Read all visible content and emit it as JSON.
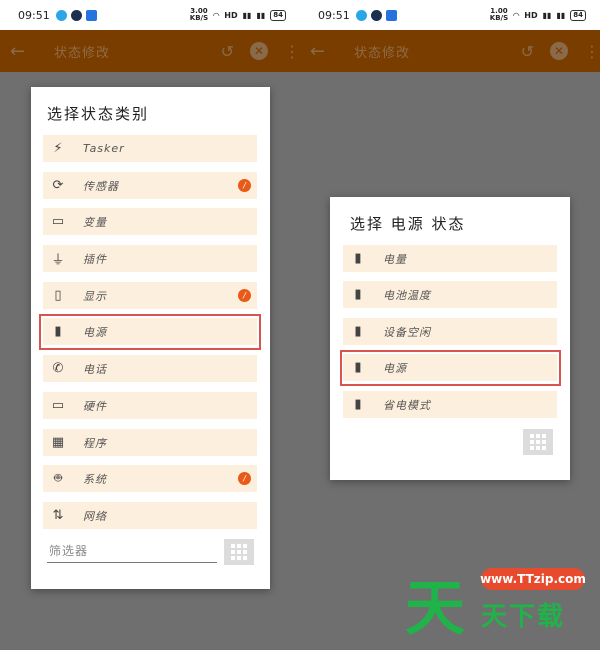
{
  "left": {
    "status": {
      "time": "09:51",
      "speed_top": "3.00",
      "speed_bottom": "KB/S",
      "hd": "HD",
      "battery": "84"
    },
    "toolbar": {
      "title": "状态修改"
    },
    "dialog": {
      "title": "选择状态类别",
      "items": [
        {
          "label": "Tasker",
          "icon": "bolt-icon",
          "badge": false
        },
        {
          "label": "传感器",
          "icon": "screen-rotate-icon",
          "badge": true
        },
        {
          "label": "变量",
          "icon": "tag-icon",
          "badge": false
        },
        {
          "label": "插件",
          "icon": "plug-icon",
          "badge": false
        },
        {
          "label": "显示",
          "icon": "phone-icon",
          "badge": true
        },
        {
          "label": "电源",
          "icon": "battery-icon",
          "badge": false
        },
        {
          "label": "电话",
          "icon": "call-icon",
          "badge": false
        },
        {
          "label": "硬件",
          "icon": "laptop-icon",
          "badge": false
        },
        {
          "label": "程序",
          "icon": "apps-icon",
          "badge": false
        },
        {
          "label": "系统",
          "icon": "android-icon",
          "badge": true
        },
        {
          "label": "网络",
          "icon": "swap-vertical-icon",
          "badge": false
        }
      ],
      "filter_placeholder": "筛选器",
      "badge_symbol": "/"
    }
  },
  "right": {
    "status": {
      "time": "09:51",
      "speed_top": "1.00",
      "speed_bottom": "KB/S",
      "hd": "HD",
      "battery": "84"
    },
    "toolbar": {
      "title": "状态修改"
    },
    "dialog": {
      "title": "选择 电源 状态",
      "items": [
        {
          "label": "电量",
          "icon": "battery-icon"
        },
        {
          "label": "电池温度",
          "icon": "battery-icon"
        },
        {
          "label": "设备空闲",
          "icon": "battery-icon"
        },
        {
          "label": "电源",
          "icon": "battery-icon"
        },
        {
          "label": "省电模式",
          "icon": "battery-icon"
        }
      ]
    }
  },
  "watermark": {
    "logo": "天",
    "url": "www.TTzip.com",
    "name": "天下载"
  },
  "colors": {
    "toolbar": "#7a3d00",
    "item_bg": "#fcefdd",
    "highlight": "#d9534f",
    "badge": "#e85a18",
    "backdrop": "#6f6f6f"
  }
}
